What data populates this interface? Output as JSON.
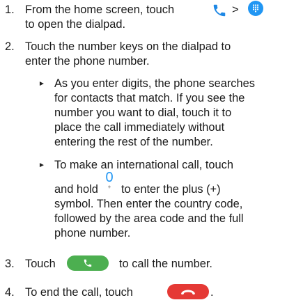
{
  "steps": [
    {
      "number": "1.",
      "text_before": "From the home screen, touch",
      "sep": ">",
      "line2": "to open the dialpad."
    },
    {
      "number": "2.",
      "lines": [
        "Touch the number keys on the dialpad to",
        "enter the phone number."
      ]
    },
    {
      "number": "3.",
      "text_before": "Touch",
      "text_after": "to call the number."
    },
    {
      "number": "4.",
      "text_before": "To end the call, touch",
      "text_after": "."
    }
  ],
  "bullets": [
    {
      "symbol": "►",
      "lines": [
        "As you enter digits, the phone searches",
        "for contacts that match. If you see the",
        "number you want to dial, touch it to",
        "place the call immediately without",
        "entering the rest of the number."
      ]
    },
    {
      "symbol": "►",
      "line1": "To make an international call, touch",
      "line2_before": "and hold",
      "line2_after": "to enter the plus (+)",
      "more_lines": [
        "symbol. Then enter the country code,",
        "followed by the area code and the full",
        "phone number."
      ]
    }
  ],
  "key_zero": {
    "digit": "0",
    "sub": "+"
  },
  "icons": {
    "phone_color": "#1e88e5",
    "dialpad_color": "#2196f3",
    "call_button_color": "#4caf50",
    "end_button_color": "#e53935"
  }
}
